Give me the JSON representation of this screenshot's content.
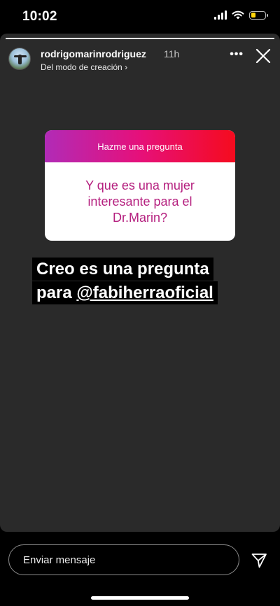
{
  "status_bar": {
    "time": "10:02",
    "battery_level": 0.35,
    "battery_color": "#ffd60a"
  },
  "story": {
    "progress": 1.0,
    "author": {
      "username": "rodrigomarinrodriguez",
      "time_ago": "11h",
      "subtitle": "Del modo de creación ›"
    },
    "more_label": "•••",
    "question_card": {
      "header": "Hazme una pregunta",
      "question": "Y que es una mujer interesante para el Dr.Marin?",
      "gradient": [
        "#b12bb7",
        "#e6107a",
        "#f50b1e"
      ],
      "question_color": "#b5207f"
    },
    "caption": {
      "line1": "Creo es una pregunta",
      "line2_prefix": "para ",
      "mention": "@fabiherraoficial"
    }
  },
  "reply": {
    "placeholder": "Enviar mensaje"
  },
  "icons": {
    "more": "more-dots-icon",
    "close": "close-icon",
    "send": "send-icon"
  }
}
